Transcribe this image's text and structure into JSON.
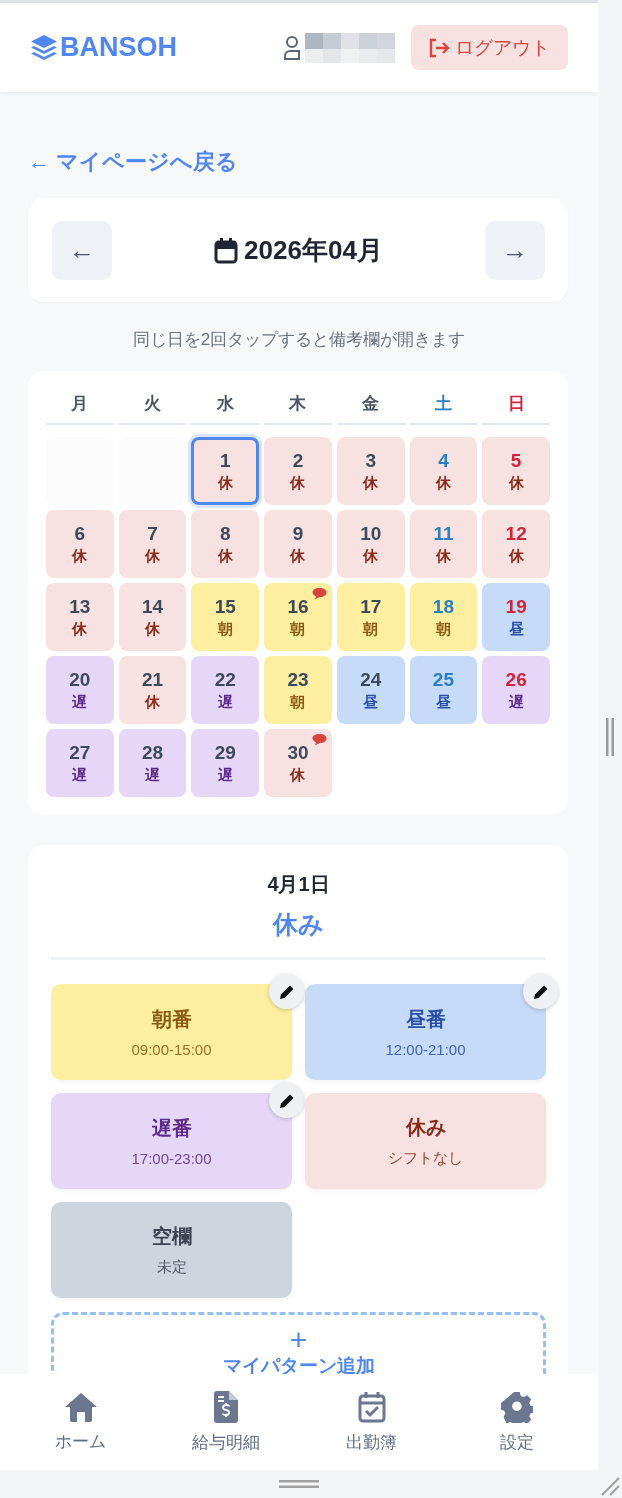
{
  "header": {
    "logo": "BANSOH",
    "logout": "ログアウト"
  },
  "back_link": "← マイページへ戻る",
  "month_nav": {
    "prev": "←",
    "title": "2026年04月",
    "next": "→"
  },
  "hint": "同じ日を2回タップすると備考欄が開きます",
  "calendar": {
    "weekdays": [
      {
        "label": "月",
        "color": "#4a5568"
      },
      {
        "label": "火",
        "color": "#4a5568"
      },
      {
        "label": "水",
        "color": "#4a5568"
      },
      {
        "label": "木",
        "color": "#4a5568"
      },
      {
        "label": "金",
        "color": "#4a5568"
      },
      {
        "label": "土",
        "color": "#2b7fc4"
      },
      {
        "label": "日",
        "color": "#d0243c"
      }
    ],
    "days": [
      {
        "kind": "empty"
      },
      {
        "kind": "empty"
      },
      {
        "day": "1",
        "shift": "休",
        "kind": "off",
        "selected": true,
        "note": false
      },
      {
        "day": "2",
        "shift": "休",
        "kind": "off",
        "selected": false,
        "note": false
      },
      {
        "day": "3",
        "shift": "休",
        "kind": "off",
        "selected": false,
        "note": false
      },
      {
        "day": "4",
        "shift": "休",
        "kind": "off",
        "selected": false,
        "note": false
      },
      {
        "day": "5",
        "shift": "休",
        "kind": "off",
        "selected": false,
        "note": false
      },
      {
        "day": "6",
        "shift": "休",
        "kind": "off",
        "selected": false,
        "note": false
      },
      {
        "day": "7",
        "shift": "休",
        "kind": "off",
        "selected": false,
        "note": false
      },
      {
        "day": "8",
        "shift": "休",
        "kind": "off",
        "selected": false,
        "note": false
      },
      {
        "day": "9",
        "shift": "休",
        "kind": "off",
        "selected": false,
        "note": false
      },
      {
        "day": "10",
        "shift": "休",
        "kind": "off",
        "selected": false,
        "note": false
      },
      {
        "day": "11",
        "shift": "休",
        "kind": "off",
        "selected": false,
        "note": false
      },
      {
        "day": "12",
        "shift": "休",
        "kind": "off",
        "selected": false,
        "note": false
      },
      {
        "day": "13",
        "shift": "休",
        "kind": "off",
        "selected": false,
        "note": false
      },
      {
        "day": "14",
        "shift": "休",
        "kind": "off",
        "selected": false,
        "note": false
      },
      {
        "day": "15",
        "shift": "朝",
        "kind": "early",
        "selected": false,
        "note": false
      },
      {
        "day": "16",
        "shift": "朝",
        "kind": "early",
        "selected": false,
        "note": true
      },
      {
        "day": "17",
        "shift": "朝",
        "kind": "early",
        "selected": false,
        "note": false
      },
      {
        "day": "18",
        "shift": "朝",
        "kind": "early",
        "selected": false,
        "note": false
      },
      {
        "day": "19",
        "shift": "昼",
        "kind": "noon",
        "selected": false,
        "note": false
      },
      {
        "day": "20",
        "shift": "遅",
        "kind": "late",
        "selected": false,
        "note": false
      },
      {
        "day": "21",
        "shift": "休",
        "kind": "off",
        "selected": false,
        "note": false
      },
      {
        "day": "22",
        "shift": "遅",
        "kind": "late",
        "selected": false,
        "note": false
      },
      {
        "day": "23",
        "shift": "朝",
        "kind": "early",
        "selected": false,
        "note": false
      },
      {
        "day": "24",
        "shift": "昼",
        "kind": "noon",
        "selected": false,
        "note": false
      },
      {
        "day": "25",
        "shift": "昼",
        "kind": "noon",
        "selected": false,
        "note": false
      },
      {
        "day": "26",
        "shift": "遅",
        "kind": "late",
        "selected": false,
        "note": false
      },
      {
        "day": "27",
        "shift": "遅",
        "kind": "late",
        "selected": false,
        "note": false
      },
      {
        "day": "28",
        "shift": "遅",
        "kind": "late",
        "selected": false,
        "note": false
      },
      {
        "day": "29",
        "shift": "遅",
        "kind": "late",
        "selected": false,
        "note": false
      },
      {
        "day": "30",
        "shift": "休",
        "kind": "off",
        "selected": false,
        "note": true
      }
    ]
  },
  "detail": {
    "date": "4月1日",
    "status": "休み",
    "patterns": [
      {
        "name": "朝番",
        "time": "09:00-15:00",
        "kind": "early",
        "editable": true
      },
      {
        "name": "昼番",
        "time": "12:00-21:00",
        "kind": "noon",
        "editable": true
      },
      {
        "name": "遅番",
        "time": "17:00-23:00",
        "kind": "late",
        "editable": true
      },
      {
        "name": "休み",
        "time": "シフトなし",
        "kind": "off",
        "editable": false
      },
      {
        "name": "空欄",
        "time": "未定",
        "kind": "blank",
        "editable": false
      }
    ],
    "add": {
      "icon": "+",
      "label": "マイパターン追加"
    }
  },
  "nav": [
    {
      "label": "ホーム"
    },
    {
      "label": "給与明細"
    },
    {
      "label": "出勤簿"
    },
    {
      "label": "設定"
    }
  ]
}
